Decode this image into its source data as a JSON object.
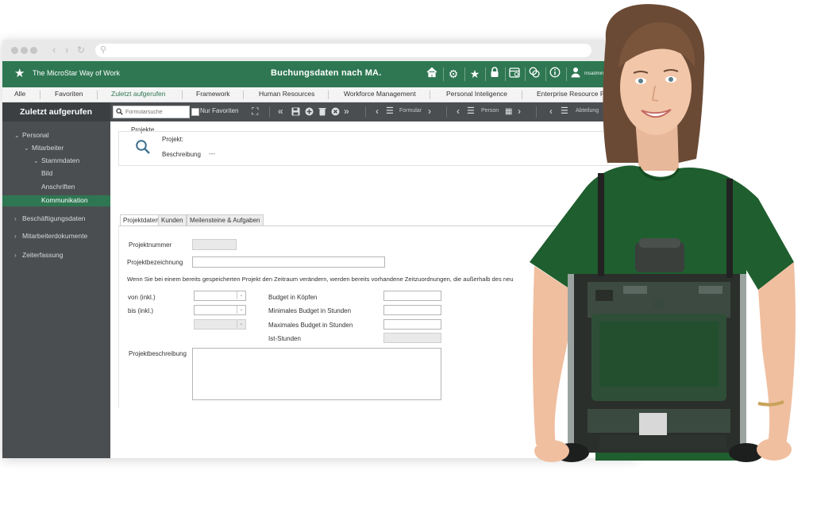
{
  "app": {
    "brand": "The MicroStar Way of Work",
    "title": "Buchungsdaten nach MA.",
    "user": "msadmin"
  },
  "menu": [
    "Alle",
    "Favoriten",
    "Zuletzt aufgerufen",
    "Framework",
    "Human Resources",
    "Workforce Management",
    "Personal Inteligence",
    "Enterprise Resource Pla"
  ],
  "menu_active": "Zuletzt aufgerufen",
  "sidebar": {
    "header": "Zuletzt aufgerufen",
    "tree": [
      {
        "label": "Personal",
        "expanded": true
      },
      {
        "label": "Mitarbeiter",
        "expanded": true
      },
      {
        "label": "Stammdaten",
        "expanded": true
      },
      {
        "label": "Bild"
      },
      {
        "label": "Anschriften"
      },
      {
        "label": "Kommunikation",
        "active": true
      },
      {
        "label": "Beschäftigungsdaten",
        "expanded": false
      },
      {
        "label": "Mitarbeiterdokumente",
        "expanded": false
      },
      {
        "label": "Zeiterfassung",
        "expanded": false
      }
    ]
  },
  "toolbar": {
    "search_placeholder": "Formularsuche",
    "fav_label": "Nur Favoriten",
    "nav_formular": "Formular",
    "nav_person": "Person",
    "nav_abteilung": "Abteilung"
  },
  "projekt": {
    "section": "Projekte",
    "label_projekt": "Projekt:",
    "label_beschreibung": "Beschreibung",
    "beschreibung_value": "---"
  },
  "tabs": [
    "Projektdaten",
    "Kunden",
    "Meilensteine & Aufgaben"
  ],
  "tab_active": "Projektdaten",
  "form": {
    "projektnummer": "Projektnummer",
    "projektbezeichnung": "Projektbezeichnung",
    "notice": "Wenn Sie bei einem bereits gespeicherten Projekt den Zeitraum verändern, werden bereits vorhandene Zeitzuordnungen, die außerhalb des neu",
    "von": "von (inkl.)",
    "bis": "bis (inkl.)",
    "budget_koepfe": "Budget in Köpfen",
    "min_budget": "Minimales Budget in Stunden",
    "max_budget": "Maximales Budget in Stunden",
    "ist_stunden": "Ist-Stunden",
    "projektbeschreibung": "Projektbeschreibung"
  },
  "colors": {
    "brand_green": "#2e7752",
    "sidebar_dark": "#4a4e51",
    "header_dark": "#3b3f42"
  }
}
